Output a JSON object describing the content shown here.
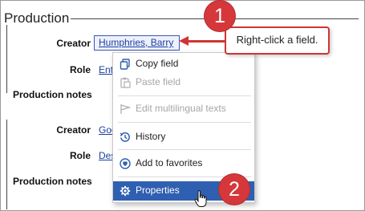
{
  "section": {
    "title": "Production"
  },
  "group1": {
    "creator_label": "Creator",
    "creator_value": "Humphries, Barry",
    "role_label": "Role",
    "role_value": "Ent",
    "notes_label": "Production notes"
  },
  "group2": {
    "creator_label": "Creator",
    "creator_value": "Goo",
    "role_label": "Role",
    "role_value": "Des",
    "notes_label": "Production notes"
  },
  "context_menu": {
    "items": [
      {
        "label": "Copy field",
        "icon": "copy-icon",
        "enabled": true
      },
      {
        "label": "Paste field",
        "icon": "paste-icon",
        "enabled": false
      },
      {
        "label": "Edit multilingual texts",
        "icon": "flag-icon",
        "enabled": false
      },
      {
        "label": "History",
        "icon": "history-icon",
        "enabled": true
      },
      {
        "label": "Add to favorites",
        "icon": "favorite-icon",
        "enabled": true
      },
      {
        "label": "Properties",
        "icon": "gear-icon",
        "enabled": true,
        "selected": true
      }
    ]
  },
  "annotation": {
    "callout_text": "Right-click a field.",
    "step1": "1",
    "step2": "2",
    "accent_color": "#d13434",
    "selection_color": "#2f5fb0"
  }
}
